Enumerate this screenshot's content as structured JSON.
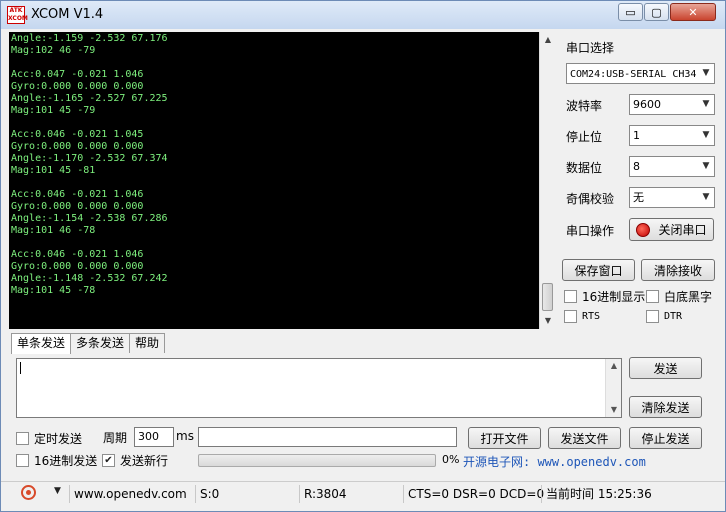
{
  "window": {
    "title": "XCOM V1.4",
    "logo_text": "ATK XCOM",
    "minimize_glyph": "▭",
    "maximize_glyph": "▢",
    "close_glyph": "✕"
  },
  "terminal": {
    "text": "Angle:-1.159 -2.532 67.176\nMag:102 46 -79\n\nAcc:0.047 -0.021 1.046\nGyro:0.000 0.000 0.000\nAngle:-1.165 -2.527 67.225\nMag:101 45 -79\n\nAcc:0.046 -0.021 1.045\nGyro:0.000 0.000 0.000\nAngle:-1.170 -2.532 67.374\nMag:101 45 -81\n\nAcc:0.046 -0.021 1.046\nGyro:0.000 0.000 0.000\nAngle:-1.154 -2.538 67.286\nMag:101 46 -78\n\nAcc:0.046 -0.021 1.046\nGyro:0.000 0.000 0.000\nAngle:-1.148 -2.532 67.242\nMag:101 45 -78",
    "text_color": "#7ef07e"
  },
  "settings": {
    "port_label": "串口选择",
    "port_value": "COM24:USB-SERIAL CH34",
    "baud_label": "波特率",
    "baud_value": "9600",
    "stopbit_label": "停止位",
    "stopbit_value": "1",
    "databit_label": "数据位",
    "databit_value": "8",
    "parity_label": "奇偶校验",
    "parity_value": "无",
    "op_label": "串口操作",
    "op_button": "关闭串口",
    "save_window": "保存窗口",
    "clear_receive": "清除接收",
    "hex_display": "16进制显示",
    "white_bg": "白底黑字",
    "rts": "RTS",
    "dtr": "DTR"
  },
  "send": {
    "tabs": [
      "单条发送",
      "多条发送",
      "帮助"
    ],
    "send_button": "发送",
    "clear_send": "清除发送",
    "timed_send": "定时发送",
    "period_label": "周期",
    "period_value": "300",
    "period_unit": "ms",
    "open_file": "打开文件",
    "send_file": "发送文件",
    "stop_send": "停止发送",
    "hex_send": "16进制发送",
    "send_newline": "发送新行",
    "progress_text": "0%",
    "progress_fraction": 0,
    "promo": "开源电子网: www.openedv.com"
  },
  "status": {
    "url": "www.openedv.com",
    "s_count": "S:0",
    "r_count": "R:3804",
    "lines": "CTS=0 DSR=0 DCD=0",
    "time": "当前时间 15:25:36"
  }
}
